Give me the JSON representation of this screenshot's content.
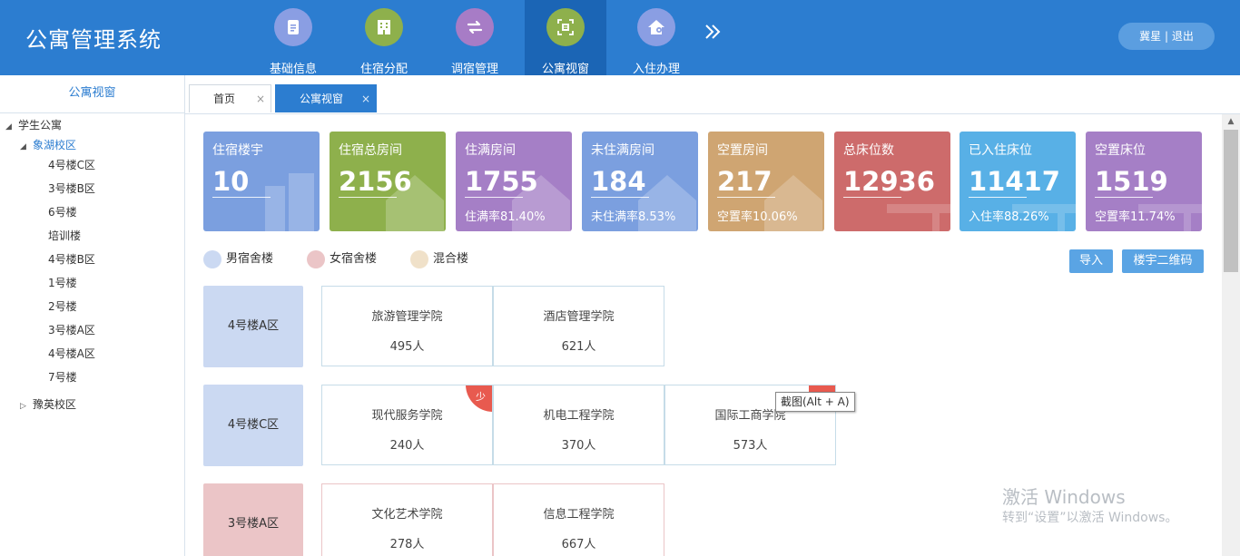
{
  "app": {
    "title": "公寓管理系统"
  },
  "nav": [
    {
      "label": "基础信息",
      "icon": "document-icon",
      "color": "#8a9ee3"
    },
    {
      "label": "住宿分配",
      "icon": "building-icon",
      "color": "#8eb04c"
    },
    {
      "label": "调宿管理",
      "icon": "swap-arrows-icon",
      "color": "#a77cc6"
    },
    {
      "label": "公寓视窗",
      "icon": "window-icon",
      "color": "#8eb04c"
    },
    {
      "label": "入住办理",
      "icon": "house-key-icon",
      "color": "#8a9ee3"
    }
  ],
  "nav_more_icon": "double-chevron-right-icon",
  "user": {
    "name": "冀星",
    "separator": " | ",
    "logout": "退出"
  },
  "sidebar": {
    "title": "公寓视窗",
    "tree": [
      {
        "label": "学生公寓",
        "expanded": true
      },
      {
        "label": "象湖校区",
        "expanded": true
      },
      {
        "label": "4号楼C区"
      },
      {
        "label": "3号楼B区"
      },
      {
        "label": "6号楼"
      },
      {
        "label": "培训楼"
      },
      {
        "label": "4号楼B区"
      },
      {
        "label": "1号楼"
      },
      {
        "label": "2号楼"
      },
      {
        "label": "3号楼A区"
      },
      {
        "label": "4号楼A区"
      },
      {
        "label": "7号楼"
      },
      {
        "label": "豫英校区",
        "expanded": false
      }
    ]
  },
  "tabs": [
    {
      "label": "首页",
      "close": "×"
    },
    {
      "label": "公寓视窗",
      "close": "×"
    }
  ],
  "stats": [
    {
      "label": "住宿楼宇",
      "value": "10",
      "sub": "",
      "color": "#7b9fdf"
    },
    {
      "label": "住宿总房间",
      "value": "2156",
      "sub": "",
      "color": "#8eb04c"
    },
    {
      "label": "住满房间",
      "value": "1755",
      "sub": "住满率81.40%",
      "color": "#a57fc6"
    },
    {
      "label": "未住满房间",
      "value": "184",
      "sub": "未住满率8.53%",
      "color": "#7b9fdf"
    },
    {
      "label": "空置房间",
      "value": "217",
      "sub": "空置率10.06%",
      "color": "#cfa572"
    },
    {
      "label": "总床位数",
      "value": "12936",
      "sub": "",
      "color": "#cd6b6b"
    },
    {
      "label": "已入住床位",
      "value": "11417",
      "sub": "入住率88.26%",
      "color": "#58b0e6"
    },
    {
      "label": "空置床位",
      "value": "1519",
      "sub": "空置率11.74%",
      "color": "#a57fc6"
    }
  ],
  "legend": [
    {
      "label": "男宿舍楼",
      "color": "#cbd9f2"
    },
    {
      "label": "女宿舍楼",
      "color": "#ebc5c7"
    },
    {
      "label": "混合楼",
      "color": "#f0e1c9"
    }
  ],
  "buttons": {
    "import": "导入",
    "qrcode": "楼宇二维码"
  },
  "buildings": [
    {
      "name": "4号楼A区",
      "type": "male",
      "colleges": [
        {
          "name": "旅游管理学院",
          "count": "495人"
        },
        {
          "name": "酒店管理学院",
          "count": "621人"
        }
      ]
    },
    {
      "name": "4号楼C区",
      "type": "male",
      "colleges": [
        {
          "name": "现代服务学院",
          "count": "240人",
          "badge": "少"
        },
        {
          "name": "机电工程学院",
          "count": "370人"
        },
        {
          "name": "国际工商学院",
          "count": "573人",
          "badge_hidden": true
        }
      ]
    },
    {
      "name": "3号楼A区",
      "type": "female",
      "colleges": [
        {
          "name": "文化艺术学院",
          "count": "278人"
        },
        {
          "name": "信息工程学院",
          "count": "667人"
        }
      ]
    }
  ],
  "tooltip": "截图(Alt + A)",
  "watermark": {
    "line1": "激活 Windows",
    "line2": "转到“设置”以激活 Windows。"
  }
}
